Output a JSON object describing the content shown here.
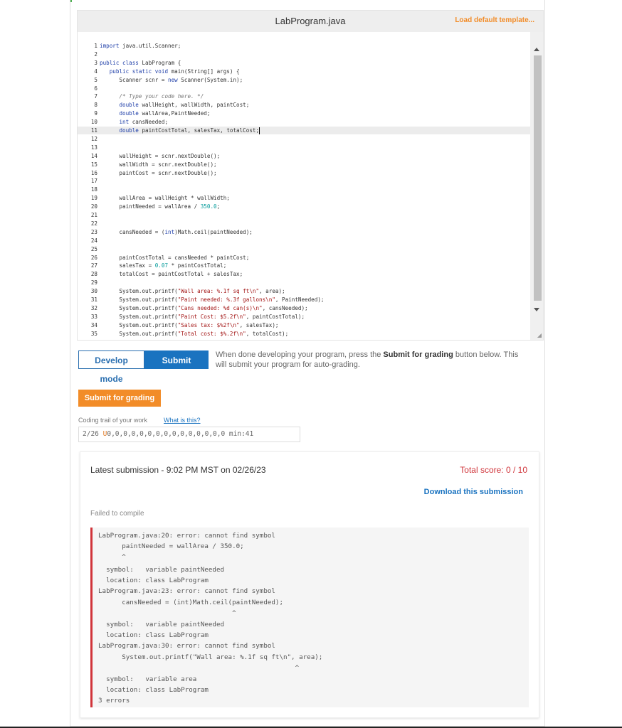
{
  "editor": {
    "filename": "LabProgram.java",
    "load_template_label": "Load default template...",
    "lines": [
      {
        "n": "1",
        "html": "<span class='kw'>import</span> java.util.Scanner;"
      },
      {
        "n": "2",
        "html": ""
      },
      {
        "n": "3",
        "html": "<span class='kw'>public class</span> LabProgram {"
      },
      {
        "n": "4",
        "html": "   <span class='kw'>public static void</span> main(String[] args) {"
      },
      {
        "n": "5",
        "html": "      Scanner scnr = <span class='kw'>new</span> Scanner(System.in);"
      },
      {
        "n": "6",
        "html": ""
      },
      {
        "n": "7",
        "html": "      <span class='cm'>/* Type your code here. */</span>"
      },
      {
        "n": "8",
        "html": "      <span class='kw'>double</span> wallHeight, wallWidth, paintCost;"
      },
      {
        "n": "9",
        "html": "      <span class='kw'>double</span> wallArea,PaintNeeded;"
      },
      {
        "n": "10",
        "html": "      <span class='kw'>int</span> cansNeeded;"
      },
      {
        "n": "11",
        "html": "      <span class='kw'>double</span> paintCostTotal, salesTax, totalCost;<span class='cursor'></span>",
        "active": true
      },
      {
        "n": "12",
        "html": ""
      },
      {
        "n": "13",
        "html": ""
      },
      {
        "n": "14",
        "html": "      wallHeight = scnr.nextDouble();"
      },
      {
        "n": "15",
        "html": "      wallWidth = scnr.nextDouble();"
      },
      {
        "n": "16",
        "html": "      paintCost = scnr.nextDouble();"
      },
      {
        "n": "17",
        "html": ""
      },
      {
        "n": "18",
        "html": ""
      },
      {
        "n": "19",
        "html": "      wallArea = wallHeight * wallWidth;"
      },
      {
        "n": "20",
        "html": "      paintNeeded = wallArea / <span class='nm'>350.0</span>;"
      },
      {
        "n": "21",
        "html": ""
      },
      {
        "n": "22",
        "html": ""
      },
      {
        "n": "23",
        "html": "      cansNeeded = (<span class='kw'>int</span>)Math.ceil(paintNeeded);"
      },
      {
        "n": "24",
        "html": ""
      },
      {
        "n": "25",
        "html": ""
      },
      {
        "n": "26",
        "html": "      paintCostTotal = cansNeeded * paintCost;"
      },
      {
        "n": "27",
        "html": "      salesTax = <span class='nm'>0.07</span> * paintCostTotal;"
      },
      {
        "n": "28",
        "html": "      totalCost = paintCostTotal + salesTax;"
      },
      {
        "n": "29",
        "html": ""
      },
      {
        "n": "30",
        "html": "      System.out.printf(<span class='st'>\"Wall area: %.1f sq ft\\n\"</span>, area);"
      },
      {
        "n": "31",
        "html": "      System.out.printf(<span class='st'>\"Paint needed: %.3f gallons\\n\"</span>, PaintNeeded);"
      },
      {
        "n": "32",
        "html": "      System.out.printf(<span class='st'>\"Cans needed: %d can(s)\\n\"</span>, cansNeeded);"
      },
      {
        "n": "33",
        "html": "      System.out.printf(<span class='st'>\"Paint Cost: $5.2f\\n\"</span>, paintCostTotal);"
      },
      {
        "n": "34",
        "html": "      System.out.printf(<span class='st'>\"Sales tax: $%2f\\n\"</span>, salesTax);"
      },
      {
        "n": "35",
        "html": "      System.out.printf(<span class='st'>\"Total cost: $%.2f\\n\"</span>, totalCost);"
      },
      {
        "n": "36",
        "html": "   }"
      }
    ]
  },
  "mode": {
    "develop_label": "Develop mode",
    "submit_label": "Submit mode",
    "desc_before": "When done developing your program, press the ",
    "desc_bold": "Submit for grading",
    "desc_after": " button below. This will submit your program for auto-grading."
  },
  "submit_button_label": "Submit for grading",
  "trail": {
    "label": "Coding trail of your work",
    "link": "What is this?",
    "prefix": "2/26 ",
    "u_mark": "U",
    "values": "0,0,0,0,0,0,0,0,0,0,0,0,0,0,0 min:41"
  },
  "submission": {
    "latest": "Latest submission - 9:02 PM MST on 02/26/23",
    "total_score": "Total score: 0 / 10",
    "download": "Download this submission",
    "failed": "Failed to compile",
    "errors": [
      "LabProgram.java:20: error: cannot find symbol",
      "      paintNeeded = wallArea / 350.0;",
      "      ^",
      "  symbol:   variable paintNeeded",
      "  location: class LabProgram",
      "LabProgram.java:23: error: cannot find symbol",
      "      cansNeeded = (int)Math.ceil(paintNeeded);",
      "                                  ^",
      "  symbol:   variable paintNeeded",
      "  location: class LabProgram",
      "LabProgram.java:30: error: cannot find symbol",
      "      System.out.printf(\"Wall area: %.1f sq ft\\n\", area);",
      "                                                  ^",
      "  symbol:   variable area",
      "  location: class LabProgram",
      "3 errors"
    ]
  }
}
